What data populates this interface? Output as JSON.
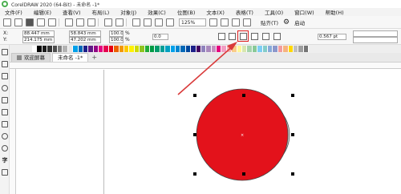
{
  "app": {
    "title": "CorelDRAW 2020 (64-Bit) - 未命名 -1*"
  },
  "menu": [
    "文件(F)",
    "编辑(E)",
    "查看(V)",
    "布局(L)",
    "对象(J)",
    "效果(C)",
    "位图(B)",
    "文本(X)",
    "表格(T)",
    "工具(O)",
    "窗口(W)",
    "帮助(H)"
  ],
  "toolbar": {
    "zoom": "125%",
    "snap_label": "贴齐(T)",
    "launch_label": "启动"
  },
  "props": {
    "x_label": "X:",
    "y_label": "Y:",
    "x_value": "88.447 mm",
    "y_value": "214.175 mm",
    "w_value": "58.843 mm",
    "h_value": "47.202 mm",
    "scale_w": "100.0",
    "scale_h": "100.0",
    "pct": "%",
    "rotation": "0.0",
    "outline": "0.567 pt"
  },
  "tabs": {
    "welcome": "欢迎屏幕",
    "doc": "未命名 -1*",
    "add": "+"
  },
  "palette": [
    "#ffffff",
    "#000000",
    "#1a1a1a",
    "#333333",
    "#4d4d4d",
    "#808080",
    "#b3b3b3",
    "#e6e6e6",
    "#00a0e9",
    "#0068b7",
    "#1d2088",
    "#601986",
    "#920783",
    "#e4007f",
    "#e5004f",
    "#e60012",
    "#eb6100",
    "#f39800",
    "#fcc800",
    "#fff100",
    "#cfdb00",
    "#8fc31f",
    "#22ac38",
    "#009944",
    "#009b6b",
    "#009e96",
    "#00a0c1",
    "#00a0e9",
    "#0086d1",
    "#0068b7",
    "#00479d",
    "#1d2088",
    "#440062",
    "#8f82bc",
    "#aa89bd",
    "#c490bf",
    "#e4007f",
    "#f19ec2",
    "#f5b2b2",
    "#facd89",
    "#fff799",
    "#d7e7af",
    "#a5d4ad",
    "#89c997",
    "#7ecef4",
    "#84ccc9",
    "#88abda",
    "#8c97cb",
    "#f29c9f",
    "#f6b37f",
    "#ffd700",
    "#c0c0c0",
    "#9e9e9e",
    "#757575"
  ],
  "colors": {
    "red_circle": "#e3121b",
    "gray_circle": "#cfcfcf",
    "arrow": "#d93a3a",
    "highlight": "#e02020"
  }
}
